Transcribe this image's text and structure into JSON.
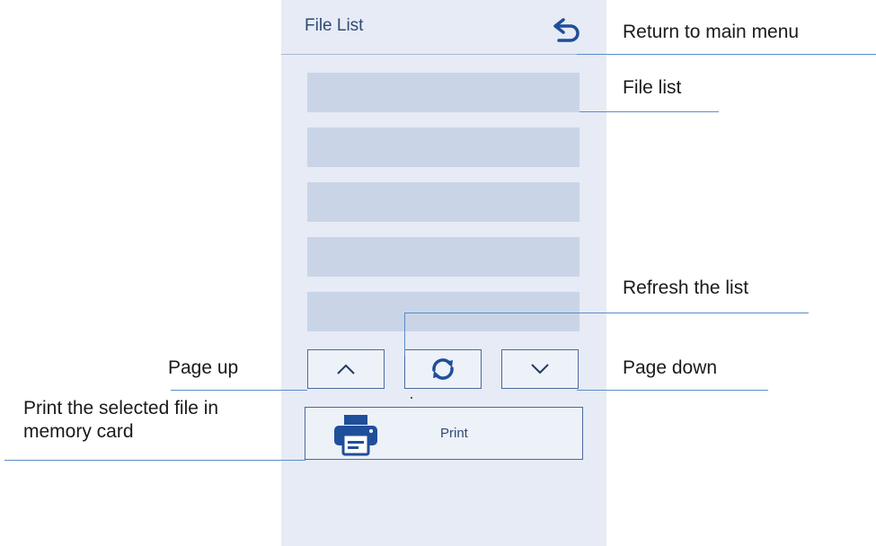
{
  "screen": {
    "title": "File List",
    "file_rows": 5,
    "print_label": "Print"
  },
  "callouts": {
    "return": "Return to main menu",
    "file_list": "File list",
    "refresh": "Refresh the list",
    "page_up": "Page up",
    "page_down": "Page down",
    "print": "Print the selected file in memory card"
  },
  "icons": {
    "back": "return-arrow-icon",
    "page_up": "chevron-up-icon",
    "refresh": "refresh-icon",
    "page_down": "chevron-down-icon",
    "print": "printer-icon"
  },
  "colors": {
    "screen_bg": "#e6ebf5",
    "row": "#c9d4e7",
    "accent": "#1f4f9a",
    "leader": "#5b8ec7"
  }
}
